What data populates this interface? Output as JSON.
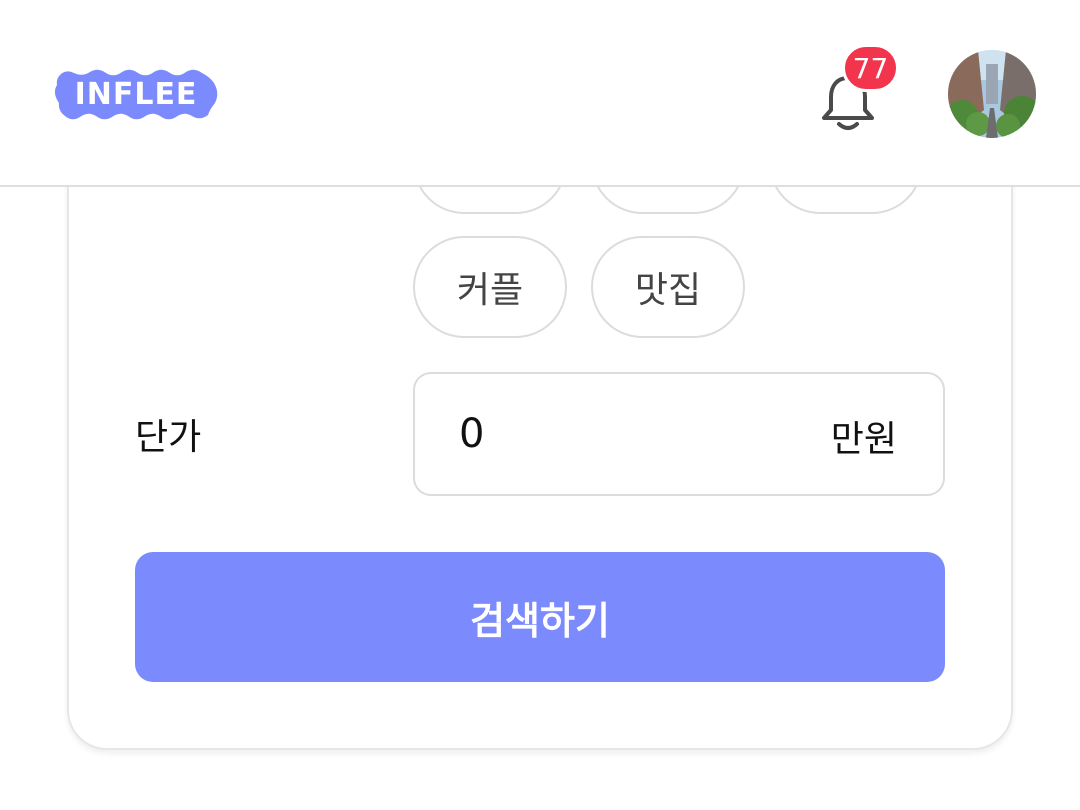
{
  "header": {
    "logo_text": "INFLEE",
    "notification_count": "77",
    "brand_color": "#7b8afc",
    "badge_color": "#f2344d"
  },
  "filters": {
    "category_chips": [
      {
        "label": ""
      },
      {
        "label": ""
      },
      {
        "label": ""
      },
      {
        "label": "커플"
      },
      {
        "label": "맛집"
      }
    ],
    "price": {
      "label": "단가",
      "value": "0",
      "unit": "만원"
    }
  },
  "search_button": {
    "label": "검색하기"
  }
}
